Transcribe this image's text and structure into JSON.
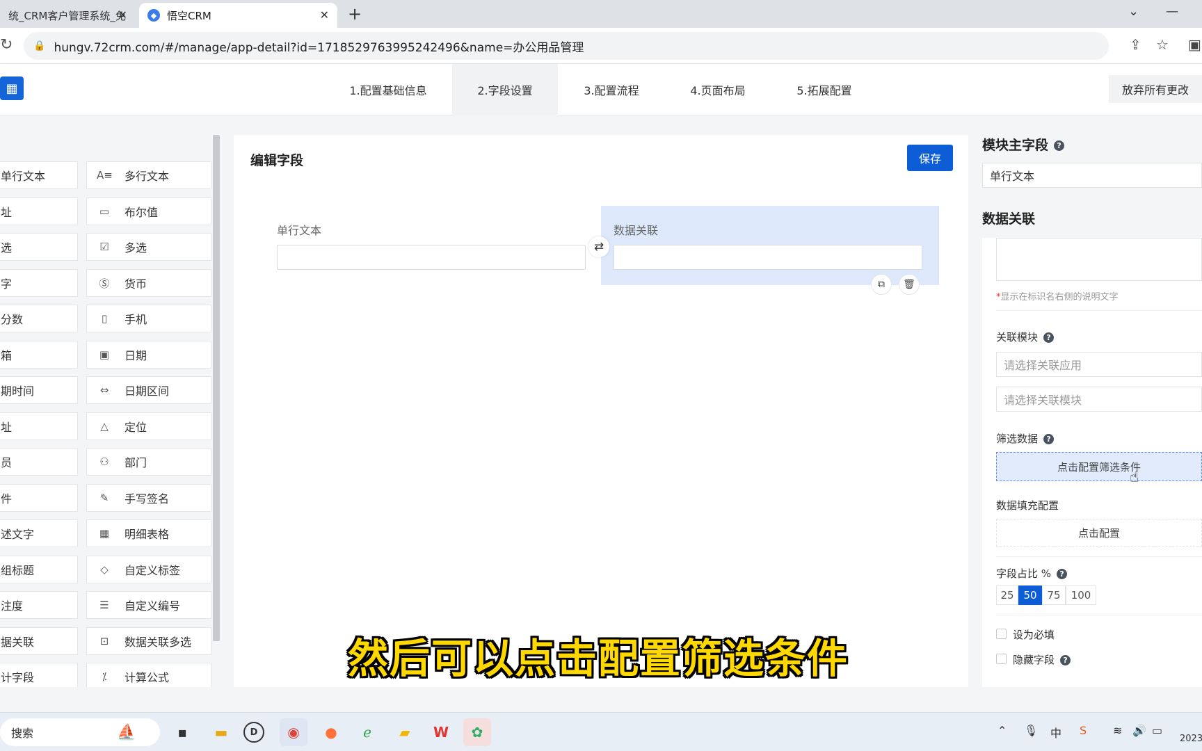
{
  "browser": {
    "tabs": [
      {
        "title": "统_CRM客户管理系统_免",
        "close": "✕"
      },
      {
        "title": "悟空CRM",
        "close": "✕"
      }
    ],
    "new_tab": "+",
    "url": "hungv.72crm.com/#/manage/app-detail?id=1718529763995242496&name=办公用品管理"
  },
  "header": {
    "steps": [
      "1.配置基础信息",
      "2.字段设置",
      "3.配置流程",
      "4.页面布局",
      "5.拓展配置"
    ],
    "active_step": 1,
    "discard_label": "放弃所有更改"
  },
  "palette": {
    "col1": [
      "单行文本",
      "址",
      "选",
      "字",
      "分数",
      "箱",
      "期时间",
      "址",
      "员",
      "件",
      "述文字",
      "组标题",
      "注度",
      "据关联",
      "计字段"
    ],
    "col2": [
      {
        "label": "多行文本",
        "icon": "multiline-text-icon",
        "glyph": "A≡"
      },
      {
        "label": "布尔值",
        "icon": "boolean-icon",
        "glyph": "▭"
      },
      {
        "label": "多选",
        "icon": "checkbox-icon",
        "glyph": "☑"
      },
      {
        "label": "货币",
        "icon": "currency-icon",
        "glyph": "Ⓢ"
      },
      {
        "label": "手机",
        "icon": "phone-icon",
        "glyph": "▯"
      },
      {
        "label": "日期",
        "icon": "calendar-icon",
        "glyph": "▣"
      },
      {
        "label": "日期区间",
        "icon": "date-range-icon",
        "glyph": "⇔"
      },
      {
        "label": "定位",
        "icon": "location-icon",
        "glyph": "△"
      },
      {
        "label": "部门",
        "icon": "department-icon",
        "glyph": "⚇"
      },
      {
        "label": "手写签名",
        "icon": "pen-icon",
        "glyph": "✎"
      },
      {
        "label": "明细表格",
        "icon": "table-icon",
        "glyph": "▦"
      },
      {
        "label": "自定义标签",
        "icon": "tag-icon",
        "glyph": "◇"
      },
      {
        "label": "自定义编号",
        "icon": "list-icon",
        "glyph": "☰"
      },
      {
        "label": "数据关联多选",
        "icon": "relation-icon",
        "glyph": "⊡"
      },
      {
        "label": "计算公式",
        "icon": "formula-icon",
        "glyph": "⁒"
      }
    ]
  },
  "editor": {
    "title": "编辑字段",
    "save_label": "保存",
    "fields": [
      {
        "label": "单行文本"
      },
      {
        "label": "数据关联"
      }
    ]
  },
  "right_panel": {
    "main_field_heading": "模块主字段",
    "main_field_value": "单行文本",
    "relation_heading": "数据关联",
    "note_star": "*",
    "note_text": "显示在标识名右侧的说明文字",
    "related_module_label": "关联模块",
    "select_app_placeholder": "请选择关联应用",
    "select_module_placeholder": "请选择关联模块",
    "filter_label": "筛选数据",
    "filter_button": "点击配置筛选条件",
    "fill_label": "数据填充配置",
    "fill_button": "点击配置",
    "ratio_label": "字段占比 %",
    "ratio_options": [
      "25",
      "50",
      "75",
      "100"
    ],
    "ratio_selected": "50",
    "required_label": "设为必填",
    "hidden_label": "隐藏字段",
    "help_glyph": "?"
  },
  "subtitle": "然后可以点击配置筛选条件",
  "taskbar": {
    "search_label": "搜索",
    "clock_partial": "2023"
  },
  "colors": {
    "primary": "#0d5ed6",
    "relation_highlight": "#dde9fb",
    "subtitle": "#ffd800"
  }
}
